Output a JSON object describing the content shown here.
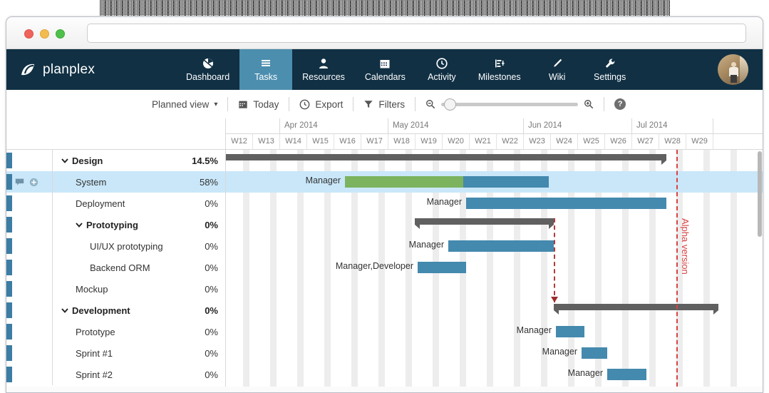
{
  "browser": {
    "url_value": "",
    "url_placeholder": "",
    "traffic_lights": [
      "close",
      "minimize",
      "zoom"
    ]
  },
  "brand": {
    "name": "planplex",
    "logo_icon": "planplex-logo-icon"
  },
  "nav": {
    "items": [
      {
        "label": "Dashboard",
        "icon": "pie-chart-icon",
        "active": false
      },
      {
        "label": "Tasks",
        "icon": "list-lines-icon",
        "active": true
      },
      {
        "label": "Resources",
        "icon": "person-icon",
        "active": false
      },
      {
        "label": "Calendars",
        "icon": "calendar-icon",
        "active": false
      },
      {
        "label": "Activity",
        "icon": "clock-icon",
        "active": false
      },
      {
        "label": "Milestones",
        "icon": "milestone-icon",
        "active": false
      },
      {
        "label": "Wiki",
        "icon": "pencil-icon",
        "active": false
      },
      {
        "label": "Settings",
        "icon": "wrench-icon",
        "active": false
      }
    ],
    "avatar_name": "user-avatar"
  },
  "toolbar": {
    "view_label": "Planned view",
    "view_caret": "▾",
    "today_label": "Today",
    "export_label": "Export",
    "filters_label": "Filters",
    "zoom_out_icon": "zoom-out-icon",
    "zoom_in_icon": "zoom-in-icon",
    "help_label": "?"
  },
  "timeline": {
    "months": [
      {
        "label": "",
        "weeks": 2
      },
      {
        "label": "Apr 2014",
        "weeks": 4
      },
      {
        "label": "May 2014",
        "weeks": 5
      },
      {
        "label": "Jun 2014",
        "weeks": 4
      },
      {
        "label": "Jul 2014",
        "weeks": 3
      }
    ],
    "weeks": [
      "W12",
      "W13",
      "W14",
      "W15",
      "W16",
      "W17",
      "W18",
      "W19",
      "W20",
      "W21",
      "W22",
      "W23",
      "W24",
      "W25",
      "W26",
      "W27",
      "W28",
      "W29"
    ],
    "milestone": {
      "label": "Alpha version",
      "color": "#d94141",
      "week_index": 16
    }
  },
  "colors": {
    "nav_bg": "#113044",
    "nav_active": "#4c8eae",
    "bar_blue": "#4489ae",
    "bar_green": "#7cb35f",
    "summary_gray": "#606060",
    "row_selected": "#c9e7f9",
    "rail_blue": "#3c7da3",
    "milestone_red": "#d94141"
  },
  "tasks": [
    {
      "name": "Design",
      "pct": "14.5%",
      "level": 0,
      "group": true,
      "selected": false,
      "has_icons": false,
      "bar": {
        "kind": "summary",
        "start": 0,
        "end": 618,
        "progress": 0
      },
      "label": ""
    },
    {
      "name": "System",
      "pct": "58%",
      "level": 1,
      "group": false,
      "selected": true,
      "has_icons": true,
      "bar": {
        "kind": "task",
        "start": 167,
        "end": 453,
        "progress": 58
      },
      "label": "Manager"
    },
    {
      "name": "Deployment",
      "pct": "0%",
      "level": 1,
      "group": false,
      "selected": false,
      "has_icons": false,
      "bar": {
        "kind": "task",
        "start": 337,
        "end": 618,
        "progress": 0
      },
      "label": "Manager"
    },
    {
      "name": "Prototyping",
      "pct": "0%",
      "level": 1,
      "group": true,
      "selected": false,
      "has_icons": false,
      "bar": {
        "kind": "summary",
        "start": 265,
        "end": 460,
        "progress": 0
      },
      "label": ""
    },
    {
      "name": "UI/UX prototyping",
      "pct": "0%",
      "level": 2,
      "group": false,
      "selected": false,
      "has_icons": false,
      "bar": {
        "kind": "task",
        "start": 312,
        "end": 460,
        "progress": 0
      },
      "label": "Manager"
    },
    {
      "name": "Backend ORM",
      "pct": "0%",
      "level": 2,
      "group": false,
      "selected": false,
      "has_icons": false,
      "bar": {
        "kind": "task",
        "start": 269,
        "end": 337,
        "progress": 0
      },
      "label": "Manager,Developer"
    },
    {
      "name": "Mockup",
      "pct": "0%",
      "level": 1,
      "group": false,
      "selected": false,
      "has_icons": false,
      "bar": null,
      "label": ""
    },
    {
      "name": "Development",
      "pct": "0%",
      "level": 0,
      "group": true,
      "selected": false,
      "has_icons": false,
      "bar": {
        "kind": "summary",
        "start": 460,
        "end": 691,
        "progress": 0
      },
      "label": ""
    },
    {
      "name": "Prototype",
      "pct": "0%",
      "level": 1,
      "group": false,
      "selected": false,
      "has_icons": false,
      "bar": {
        "kind": "task",
        "start": 463,
        "end": 503,
        "progress": 0
      },
      "label": "Manager"
    },
    {
      "name": "Sprint #1",
      "pct": "0%",
      "level": 1,
      "group": false,
      "selected": false,
      "has_icons": false,
      "bar": {
        "kind": "task",
        "start": 499,
        "end": 535,
        "progress": 0
      },
      "label": "Manager"
    },
    {
      "name": "Sprint #2",
      "pct": "0%",
      "level": 1,
      "group": false,
      "selected": false,
      "has_icons": false,
      "bar": {
        "kind": "task",
        "start": 535,
        "end": 590,
        "progress": 0
      },
      "label": "Manager"
    }
  ],
  "icons": {
    "comment": "comment-icon",
    "add": "add-circle-icon",
    "caret_down": "❯"
  }
}
